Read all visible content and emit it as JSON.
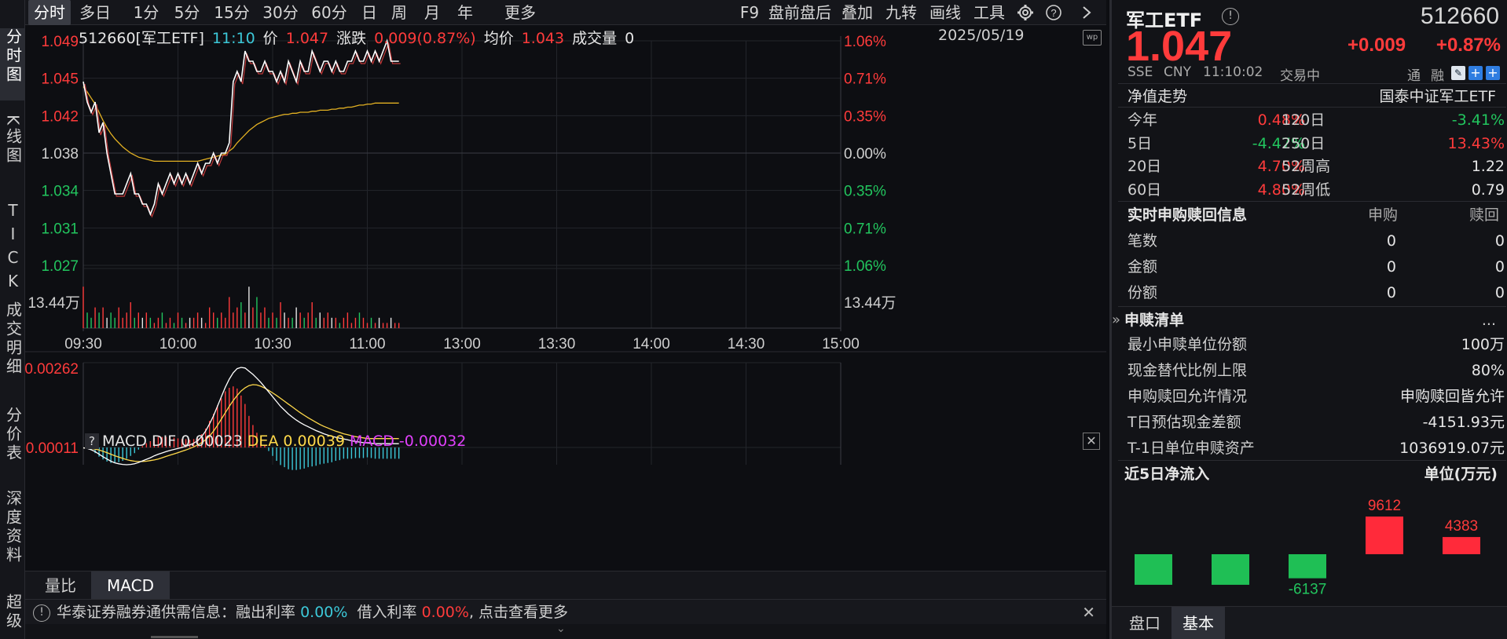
{
  "leftnav": [
    "分时图",
    "K线图",
    "TICK",
    "成交明细",
    "分价表",
    "深度资料",
    "超级"
  ],
  "toolbar": {
    "periods": [
      "分时",
      "多日",
      "1分",
      "5分",
      "15分",
      "30分",
      "60分",
      "日",
      "周",
      "月",
      "年",
      "更多"
    ],
    "tools": [
      "F9",
      "盘前盘后",
      "叠加",
      "九转",
      "画线",
      "工具"
    ]
  },
  "info": {
    "code_name": "512660[军工ETF]",
    "time": "11:10",
    "price_label": "价",
    "price": "1.047",
    "chg_label": "涨跌",
    "chg": "0.009(0.87%)",
    "avg_label": "均价",
    "avg": "1.043",
    "vol_label": "成交量",
    "vol": "0",
    "date": "2025/05/19"
  },
  "chart_data": [
    {
      "type": "line",
      "title": "",
      "x_labels": [
        "09:30",
        "10:00",
        "10:30",
        "11:00",
        "13:00",
        "13:30",
        "14:00",
        "14:30",
        "15:00"
      ],
      "y_labels_left": [
        "1.049",
        "1.045",
        "1.042",
        "1.038",
        "1.034",
        "1.031",
        "1.027"
      ],
      "y_labels_right": [
        "1.06%",
        "0.71%",
        "0.35%",
        "0.00%",
        "0.35%",
        "0.71%",
        "1.06%"
      ],
      "ylim": [
        1.027,
        1.049
      ],
      "prev_close": 1.038,
      "series": [
        {
          "role": "price",
          "color": "#ffffff",
          "values": [
            1.045,
            1.043,
            1.042,
            1.043,
            1.04,
            1.041,
            1.038,
            1.036,
            1.034,
            1.034,
            1.034,
            1.035,
            1.036,
            1.034,
            1.034,
            1.033,
            1.033,
            1.032,
            1.033,
            1.035,
            1.034,
            1.035,
            1.036,
            1.035,
            1.036,
            1.035,
            1.036,
            1.035,
            1.036,
            1.037,
            1.036,
            1.037,
            1.037,
            1.038,
            1.037,
            1.038,
            1.038,
            1.039,
            1.045,
            1.046,
            1.045,
            1.048,
            1.047,
            1.047,
            1.046,
            1.046,
            1.047,
            1.046,
            1.046,
            1.045,
            1.046,
            1.045,
            1.047,
            1.046,
            1.045,
            1.047,
            1.046,
            1.046,
            1.048,
            1.047,
            1.046,
            1.047,
            1.047,
            1.046,
            1.047,
            1.046,
            1.046,
            1.047,
            1.047,
            1.048,
            1.047,
            1.047,
            1.048,
            1.047,
            1.048,
            1.047,
            1.048,
            1.049,
            1.047,
            1.047,
            1.047
          ]
        },
        {
          "role": "average",
          "color": "#e2b022",
          "values": [
            1.0445,
            1.044,
            1.0434,
            1.0428,
            1.042,
            1.0412,
            1.0405,
            1.0399,
            1.0394,
            1.039,
            1.0386,
            1.0383,
            1.038,
            1.0378,
            1.0376,
            1.0375,
            1.0374,
            1.0373,
            1.0372,
            1.0372,
            1.0372,
            1.0372,
            1.0372,
            1.0372,
            1.0372,
            1.0372,
            1.0372,
            1.0372,
            1.0372,
            1.0372,
            1.0373,
            1.0374,
            1.0375,
            1.0376,
            1.0377,
            1.0378,
            1.0379,
            1.0382,
            1.0385,
            1.039,
            1.0394,
            1.0398,
            1.0402,
            1.0405,
            1.0408,
            1.041,
            1.0412,
            1.0414,
            1.0415,
            1.0416,
            1.0417,
            1.0418,
            1.0418,
            1.0419,
            1.0419,
            1.042,
            1.042,
            1.042,
            1.0421,
            1.0421,
            1.0422,
            1.0422,
            1.0422,
            1.0423,
            1.0423,
            1.0424,
            1.0424,
            1.0425,
            1.0425,
            1.0426,
            1.0427,
            1.0427,
            1.0428,
            1.0428,
            1.0429,
            1.0429,
            1.0429,
            1.0429,
            1.0429,
            1.0429,
            1.0429
          ]
        }
      ],
      "volume_label": "13.44万",
      "volume_values": [
        8,
        3,
        2,
        4,
        3,
        4,
        2,
        3,
        2,
        4,
        2,
        3,
        5,
        2,
        3,
        2,
        3,
        2,
        1,
        2,
        3,
        1,
        2,
        1,
        3,
        2,
        1,
        2,
        2,
        3,
        2,
        1,
        4,
        3,
        2,
        3,
        2,
        6,
        3,
        4,
        5,
        3,
        8,
        4,
        6,
        3,
        4,
        2,
        3,
        2,
        5,
        3,
        2,
        2,
        4,
        3,
        2,
        3,
        5,
        2,
        3,
        2,
        3,
        2,
        2,
        1,
        2,
        3,
        1,
        2,
        3,
        2,
        1,
        2,
        1,
        2,
        1,
        1,
        2,
        1,
        1
      ]
    },
    {
      "type": "line",
      "title": "MACD",
      "y_labels": [
        "0.00262",
        "0.00011"
      ],
      "dif_label": "MACD DIF",
      "dif": "0.00023",
      "dea_label": "DEA",
      "dea": "0.00039",
      "macd_label": "MACD",
      "macd": "-0.00032",
      "dif_values": [
        0.0001,
        8e-05,
        4e-05,
        -2e-05,
        -0.0001,
        -0.00018,
        -0.00025,
        -0.00032,
        -0.00037,
        -0.0004,
        -0.00042,
        -0.00043,
        -0.00042,
        -0.0004,
        -0.00036,
        -0.00031,
        -0.00026,
        -0.00021,
        -0.00015,
        -0.0001,
        -6e-05,
        -2e-05,
        2e-05,
        5e-05,
        8e-05,
        0.00011,
        0.00015,
        0.00019,
        0.00025,
        0.00032,
        0.00045,
        0.00062,
        0.00085,
        0.0011,
        0.0014,
        0.0017,
        0.002,
        0.00225,
        0.00245,
        0.00258,
        0.00262,
        0.0026,
        0.0025,
        0.0024,
        0.00228,
        0.00215,
        0.002,
        0.00185,
        0.0017,
        0.00155,
        0.0014,
        0.00128,
        0.00116,
        0.00106,
        0.00097,
        0.00089,
        0.00082,
        0.00076,
        0.0007,
        0.00064,
        0.00059,
        0.00054,
        0.0005,
        0.00046,
        0.00043,
        0.0004,
        0.00038,
        0.00035,
        0.00032,
        0.0003,
        0.00028,
        0.00026,
        0.00025,
        0.00024,
        0.00023,
        0.00023,
        0.00023,
        0.00023,
        0.00023,
        0.00023,
        0.00023
      ],
      "dea_values": [
        0.0001,
        9e-05,
        8e-05,
        6e-05,
        3e-05,
        -1e-05,
        -5e-05,
        -0.0001,
        -0.00015,
        -0.00019,
        -0.00023,
        -0.00027,
        -0.0003,
        -0.00032,
        -0.00033,
        -0.00033,
        -0.00032,
        -0.0003,
        -0.00028,
        -0.00025,
        -0.00021,
        -0.00017,
        -0.00013,
        -9e-05,
        -5e-05,
        -1e-05,
        3e-05,
        8e-05,
        0.00013,
        0.00019,
        0.00026,
        0.00035,
        0.00047,
        0.00062,
        0.0008,
        0.001,
        0.0012,
        0.0014,
        0.00158,
        0.00174,
        0.00188,
        0.00198,
        0.00205,
        0.00208,
        0.00207,
        0.00203,
        0.00197,
        0.0019,
        0.00182,
        0.00174,
        0.00165,
        0.00156,
        0.00147,
        0.00138,
        0.00129,
        0.0012,
        0.00112,
        0.00104,
        0.00097,
        0.0009,
        0.00083,
        0.00077,
        0.00072,
        0.00067,
        0.00062,
        0.00058,
        0.00054,
        0.00051,
        0.00048,
        0.00045,
        0.00043,
        0.00041,
        0.00039,
        0.00039,
        0.00039,
        0.00039,
        0.00039,
        0.00039,
        0.00039,
        0.00039,
        0.00039
      ]
    },
    {
      "type": "bar",
      "title": "近5日净流入",
      "unit": "单位(万元)",
      "values": [
        -7800,
        -7800,
        -6137,
        9612,
        4383
      ],
      "labels": [
        "",
        "",
        "-6137",
        "9612",
        "4383"
      ]
    }
  ],
  "subtabs": [
    "量比",
    "MACD"
  ],
  "notice": {
    "prefix": "华泰证券融券通供需信息：融出利率",
    "rate1": "0.00%",
    "mid": "借入利率",
    "rate2": "0.00%",
    "suffix": ", 点击查看更多"
  },
  "quote": {
    "name": "军工ETF",
    "code": "512660",
    "price": "1.047",
    "change": "+0.009",
    "pct": "+0.87%",
    "exchange": "SSE",
    "currency": "CNY",
    "time": "11:10:02",
    "status": "交易中",
    "tags": [
      "通",
      "融"
    ]
  },
  "nav_section": {
    "title": "净值走势",
    "index": "国泰中证军工ETF",
    "rows": [
      {
        "l1": "今年",
        "v1": "0.48%",
        "c1": "red",
        "l2": "120日",
        "v2": "-3.41%",
        "c2": "green"
      },
      {
        "l1": "5日",
        "v1": "-4.47%",
        "c1": "green",
        "l2": "250日",
        "v2": "13.43%",
        "c2": "red"
      },
      {
        "l1": "20日",
        "v1": "4.70%",
        "c1": "red",
        "l2": "52周高",
        "v2": "1.22",
        "c2": "white"
      },
      {
        "l1": "60日",
        "v1": "4.80%",
        "c1": "red",
        "l2": "52周低",
        "v2": "0.79",
        "c2": "white"
      }
    ]
  },
  "redeem_section": {
    "title": "实时申购赎回信息",
    "col1": "申购",
    "col2": "赎回",
    "rows": [
      {
        "label": "笔数",
        "v1": "0",
        "v2": "0"
      },
      {
        "label": "金额",
        "v1": "0",
        "v2": "0"
      },
      {
        "label": "份额",
        "v1": "0",
        "v2": "0"
      }
    ]
  },
  "list_section": {
    "title": "申赎清单",
    "more": "...",
    "rows": [
      {
        "label": "最小申赎单位份额",
        "value": "100万"
      },
      {
        "label": "现金替代比例上限",
        "value": "80%"
      },
      {
        "label": "申购赎回允许情况",
        "value": "申购赎回皆允许"
      },
      {
        "label": "T日预估现金差额",
        "value": "-4151.93元"
      },
      {
        "label": "T-1日单位申赎资产",
        "value": "1036919.07元"
      }
    ]
  },
  "bottom_tabs": [
    "盘口",
    "基本"
  ],
  "colors": {
    "up": "#ff3b3b",
    "down": "#22c55e",
    "bg": "#0d0e12",
    "avg": "#e2b022"
  }
}
